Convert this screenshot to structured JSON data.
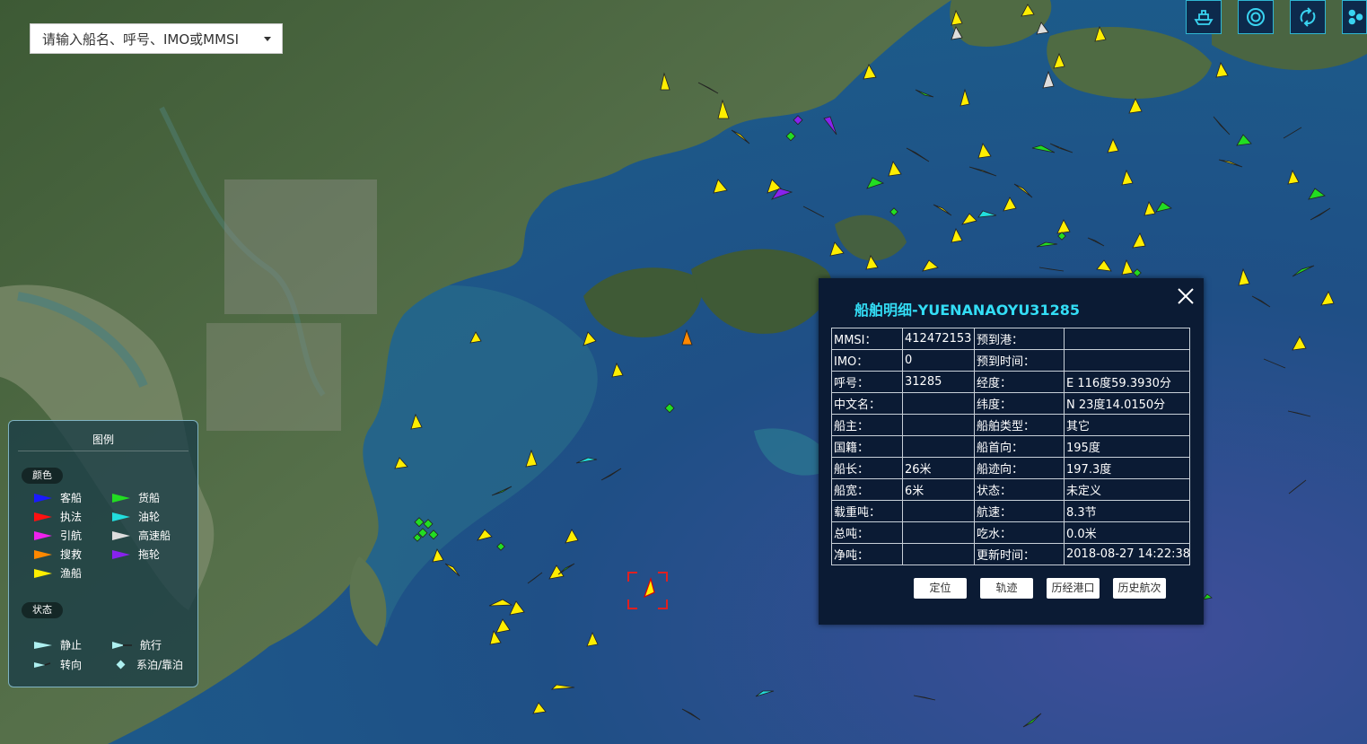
{
  "search": {
    "placeholder": "请输入船名、呼号、IMO或MMSI"
  },
  "tools": [
    {
      "icon": "ship-icon"
    },
    {
      "icon": "target-icon"
    },
    {
      "icon": "refresh-icon"
    },
    {
      "icon": "cluster-icon"
    }
  ],
  "legend": {
    "title": "图例",
    "color_section": "颜色",
    "colors": [
      {
        "label": "客船",
        "color": "#1a1aff"
      },
      {
        "label": "货船",
        "color": "#22dd22"
      },
      {
        "label": "执法",
        "color": "#ff1111"
      },
      {
        "label": "油轮",
        "color": "#22dddd"
      },
      {
        "label": "引航",
        "color": "#ee22ee"
      },
      {
        "label": "高速船",
        "color": "#dddddd"
      },
      {
        "label": "搜救",
        "color": "#ff8800"
      },
      {
        "label": "拖轮",
        "color": "#8822ee"
      },
      {
        "label": "渔船",
        "color": "#ffee00"
      }
    ],
    "status_section": "状态",
    "statuses": [
      {
        "label": "静止",
        "icon": "static-icon"
      },
      {
        "label": "航行",
        "icon": "sailing-icon"
      },
      {
        "label": "转向",
        "icon": "turning-icon"
      },
      {
        "label": "系泊/靠泊",
        "icon": "moored-icon"
      }
    ]
  },
  "panel": {
    "title": "船舶明细-YUENANAOYU31285",
    "rows": [
      {
        "k1": "MMSI：",
        "v1": "412472153",
        "k2": "预到港：",
        "v2": ""
      },
      {
        "k1": "IMO：",
        "v1": "0",
        "k2": "预到时间：",
        "v2": ""
      },
      {
        "k1": "呼号：",
        "v1": "31285",
        "k2": "经度：",
        "v2": "E 116度59.3930分"
      },
      {
        "k1": "中文名：",
        "v1": "",
        "k2": "纬度：",
        "v2": "N 23度14.0150分"
      },
      {
        "k1": "船主：",
        "v1": "",
        "k2": "船舶类型：",
        "v2": "其它"
      },
      {
        "k1": "国籍：",
        "v1": "",
        "k2": "船首向：",
        "v2": "195度"
      },
      {
        "k1": "船长：",
        "v1": "26米",
        "k2": "船迹向：",
        "v2": "197.3度"
      },
      {
        "k1": "船宽：",
        "v1": "6米",
        "k2": "状态：",
        "v2": "未定义"
      },
      {
        "k1": "载重吨：",
        "v1": "",
        "k2": "航速：",
        "v2": "8.3节"
      },
      {
        "k1": "总吨：",
        "v1": "",
        "k2": "吃水：",
        "v2": "0.0米"
      },
      {
        "k1": "净吨：",
        "v1": "",
        "k2": "更新时间：",
        "v2": "2018-08-27 14:22:38"
      }
    ],
    "buttons": [
      "定位",
      "轨迹",
      "历经港口",
      "历史航次"
    ]
  }
}
